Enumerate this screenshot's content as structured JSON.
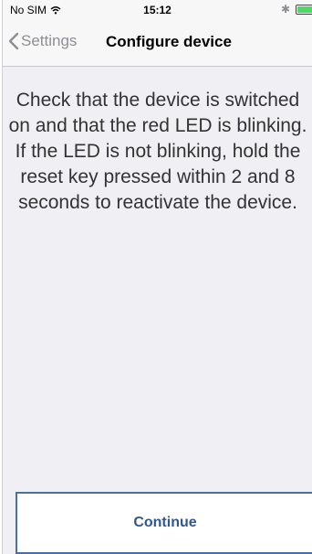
{
  "status_bar": {
    "carrier": "No SIM",
    "time": "15:12",
    "bluetooth_icon": "bluetooth-icon",
    "wifi_icon": "wifi-icon",
    "battery_icon": "battery-icon",
    "battery_color": "#4cd964"
  },
  "nav": {
    "back_label": "Settings",
    "back_icon": "chevron-left-icon",
    "title": "Configure device"
  },
  "main": {
    "message": "Check that the device is switched on and that the red LED is blinking. If the LED is not blinking, hold the reset key pressed within 2 and 8 seconds to reactivate the device."
  },
  "footer": {
    "continue_label": "Continue",
    "accent_color": "#2f5790"
  }
}
